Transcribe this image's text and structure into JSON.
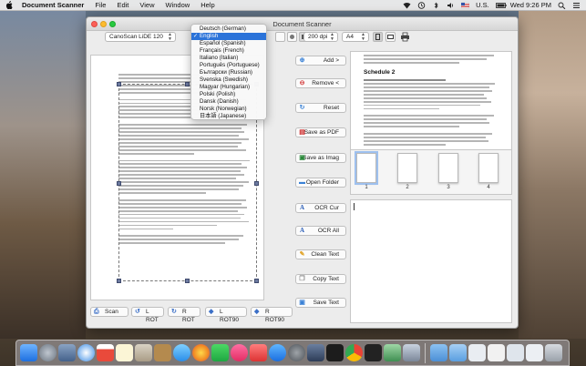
{
  "menubar": {
    "app_name": "Document Scanner",
    "menus": [
      "File",
      "Edit",
      "View",
      "Window",
      "Help"
    ],
    "input_source": "U.S.",
    "clock": "Wed 9:26 PM"
  },
  "window": {
    "title": "Document Scanner"
  },
  "toolbar": {
    "scanner": "CanoScan LiDE 120",
    "dpi": "200 dpi",
    "paper": "A4"
  },
  "language_menu": {
    "items": [
      "Deutsch (German)",
      "English",
      "Español (Spanish)",
      "Français (French)",
      "Italiano (Italian)",
      "Português (Portuguese)",
      "Български (Russian)",
      "Svenska (Swedish)",
      "Magyar (Hungarian)",
      "Polski (Polish)",
      "Dansk (Danish)",
      "Norsk (Norwegian)",
      "日本語 (Japanese)"
    ],
    "selected_index": 1
  },
  "actions": {
    "add": "Add  >",
    "remove": "Remove <",
    "reset": "Reset",
    "save_pdf": "Save as PDF",
    "save_image": "Save as Imag",
    "open_folder": "Open Folder",
    "ocr_cur": "OCR Cur",
    "ocr_all": "OCR All",
    "clean_text": "Clean Text",
    "copy_text": "Copy Text",
    "save_text": "Save Text"
  },
  "bottom": {
    "scan": "Scan",
    "l_rot": "L ROT",
    "r_rot": "R ROT",
    "l_rot90": "L ROT90",
    "r_rot90": "R ROT90"
  },
  "right_preview": {
    "heading": "Schedule 2"
  },
  "thumbnails": {
    "pages": [
      "1",
      "2",
      "3",
      "4"
    ],
    "selected_index": 0
  },
  "colors": {
    "selection_blue": "#2b73d9",
    "window_bg": "#ececec"
  }
}
